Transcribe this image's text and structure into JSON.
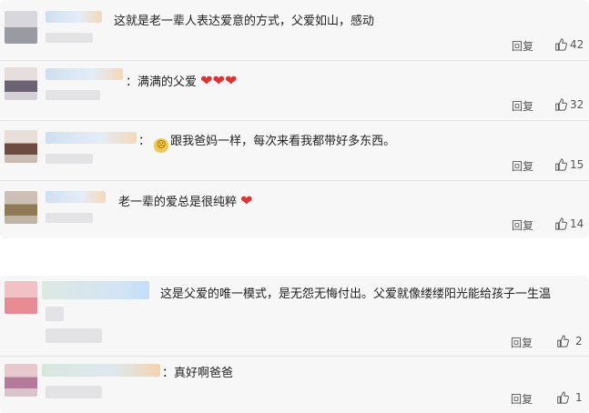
{
  "comments_group_1": [
    {
      "text": "这就是老一辈人表达爱意的方式，父爱如山，感动",
      "hearts": "",
      "emoji": "",
      "reply": "回复",
      "likes": "42"
    },
    {
      "text": "：满满的父爱",
      "hearts": "❤❤❤",
      "emoji": "",
      "reply": "回复",
      "likes": "32"
    },
    {
      "text": "：",
      "hearts": "",
      "emoji": "🙁",
      "text_after": "跟我爸妈一样，每次来看我都带好多东西。",
      "reply": "回复",
      "likes": "15"
    },
    {
      "text": "老一辈的爱总是很纯粹",
      "hearts": "❤",
      "emoji": "",
      "reply": "回复",
      "likes": "14"
    }
  ],
  "comments_group_2": [
    {
      "text": "这是父爱的唯一模式，是无怨无悔付出。父爱就像缕缕阳光能给孩子一生温",
      "reply": "回复",
      "likes": "2"
    },
    {
      "text": "：真好啊爸爸",
      "reply": "回复",
      "likes": "1"
    }
  ],
  "colors": {
    "heart": "#e0322f",
    "card_bg": "#f7f7f7",
    "text": "#222222"
  },
  "icons": {
    "like": "thumbs-up-icon",
    "love": "heart-icon",
    "emoji": "sad-face-icon"
  }
}
